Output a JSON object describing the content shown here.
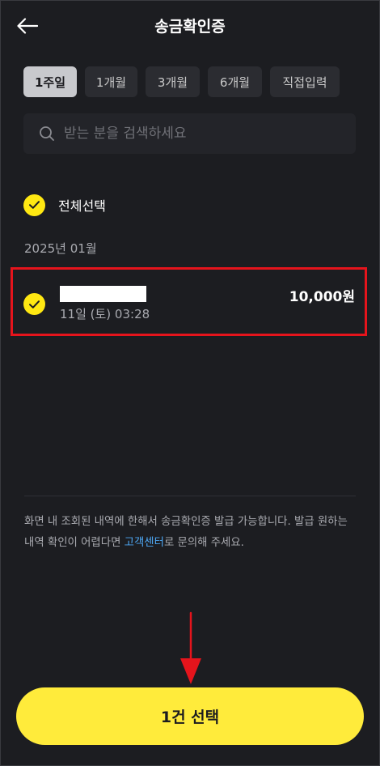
{
  "header": {
    "title": "송금확인증"
  },
  "period_chips": [
    {
      "label": "1주일",
      "active": true
    },
    {
      "label": "1개월",
      "active": false
    },
    {
      "label": "3개월",
      "active": false
    },
    {
      "label": "6개월",
      "active": false
    },
    {
      "label": "직접입력",
      "active": false
    }
  ],
  "search": {
    "placeholder": "받는 분을 검색하세요",
    "value": ""
  },
  "select_all": {
    "label": "전체선택",
    "checked": true
  },
  "month_header": "2025년 01월",
  "transactions": [
    {
      "name": "",
      "date": "11일 (토) 03:28",
      "amount": "10,000원",
      "checked": true
    }
  ],
  "notice": {
    "text_before": "화면 내 조회된 내역에 한해서 송금확인증 발급 가능합니다. 발급 원하는 내역 확인이 어렵다면 ",
    "link": "고객센터",
    "text_after": "로 문의해 주세요."
  },
  "confirm_button": {
    "label": "1건 선택"
  },
  "colors": {
    "background": "#1c1d21",
    "accent_yellow": "#ffe812",
    "highlight_red": "#e5141c",
    "link_blue": "#4ea8f5"
  }
}
